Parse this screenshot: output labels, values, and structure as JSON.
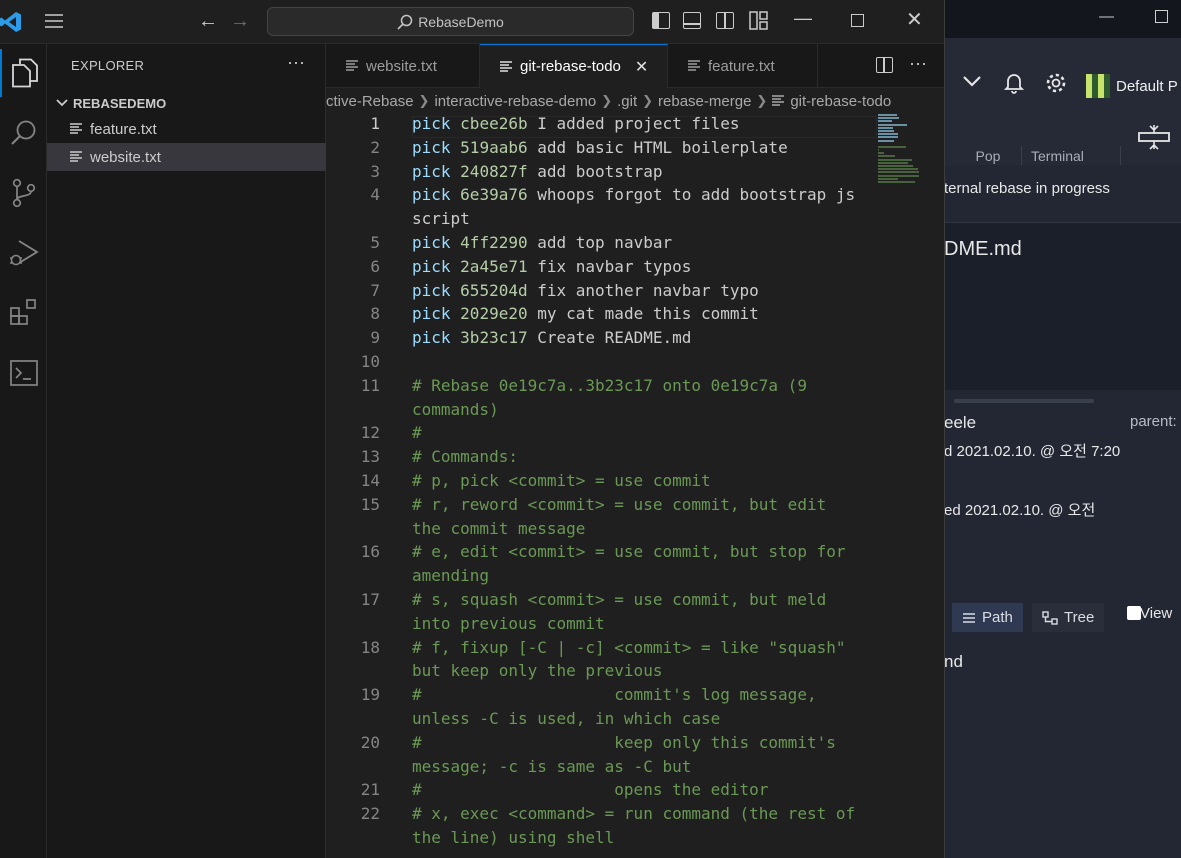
{
  "vscode": {
    "command_center": "RebaseDemo",
    "explorer": {
      "title": "EXPLORER",
      "folder": "REBASEDEMO",
      "files": [
        "feature.txt",
        "website.txt"
      ]
    },
    "tabs": [
      {
        "label": "website.txt"
      },
      {
        "label": "git-rebase-todo"
      },
      {
        "label": "feature.txt"
      }
    ],
    "breadcrumb": [
      "ctive-Rebase",
      "interactive-rebase-demo",
      ".git",
      "rebase-merge",
      "git-rebase-todo"
    ],
    "editor": {
      "current_line": 1,
      "lines": [
        {
          "n": "1",
          "kind": "pick",
          "cmd": "pick",
          "hash": "cbee26b",
          "msg": " I added project files"
        },
        {
          "n": "2",
          "kind": "pick",
          "cmd": "pick",
          "hash": "519aab6",
          "msg": " add basic HTML boilerplate"
        },
        {
          "n": "3",
          "kind": "pick",
          "cmd": "pick",
          "hash": "240827f",
          "msg": " add bootstrap"
        },
        {
          "n": "4",
          "kind": "pick",
          "cmd": "pick",
          "hash": "6e39a76",
          "msg": " whoops forgot to add bootstrap js script"
        },
        {
          "n": "5",
          "kind": "pick",
          "cmd": "pick",
          "hash": "4ff2290",
          "msg": " add top navbar"
        },
        {
          "n": "6",
          "kind": "pick",
          "cmd": "pick",
          "hash": "2a45e71",
          "msg": " fix navbar typos"
        },
        {
          "n": "7",
          "kind": "pick",
          "cmd": "pick",
          "hash": "655204d",
          "msg": " fix another navbar typo"
        },
        {
          "n": "8",
          "kind": "pick",
          "cmd": "pick",
          "hash": "2029e20",
          "msg": " my cat made this commit"
        },
        {
          "n": "9",
          "kind": "pick",
          "cmd": "pick",
          "hash": "3b23c17",
          "msg": " Create README.md"
        },
        {
          "n": "10",
          "kind": "blank",
          "text": ""
        },
        {
          "n": "11",
          "kind": "comment",
          "text": "# Rebase 0e19c7a..3b23c17 onto 0e19c7a (9 commands)"
        },
        {
          "n": "12",
          "kind": "comment",
          "text": "#"
        },
        {
          "n": "13",
          "kind": "comment",
          "text": "# Commands:"
        },
        {
          "n": "14",
          "kind": "comment",
          "text": "# p, pick <commit> = use commit"
        },
        {
          "n": "15",
          "kind": "comment",
          "text": "# r, reword <commit> = use commit, but edit the commit message"
        },
        {
          "n": "16",
          "kind": "comment",
          "text": "# e, edit <commit> = use commit, but stop for amending"
        },
        {
          "n": "17",
          "kind": "comment",
          "text": "# s, squash <commit> = use commit, but meld into previous commit"
        },
        {
          "n": "18",
          "kind": "comment",
          "text": "# f, fixup [-C | -c] <commit> = like \"squash\" but keep only the previous"
        },
        {
          "n": "19",
          "kind": "comment",
          "text": "#                    commit's log message, unless -C is used, in which case"
        },
        {
          "n": "20",
          "kind": "comment",
          "text": "#                    keep only this commit's message; -c is same as -C but"
        },
        {
          "n": "21",
          "kind": "comment",
          "text": "#                    opens the editor"
        },
        {
          "n": "22",
          "kind": "comment",
          "text": "# x, exec <command> = run command (the rest of the line) using shell"
        }
      ]
    }
  },
  "background_app": {
    "profile": "Default P",
    "toolbar": {
      "pop": "Pop",
      "terminal": "Terminal"
    },
    "banner": "ternal rebase in progress",
    "file_title": "DME.md",
    "author": "eele",
    "parent_label": "parent:",
    "authored": "d  2021.02.10. @ 오전 7:20",
    "committed": "ed  2021.02.10. @ 오전",
    "view_path": "Path",
    "view_tree": "Tree",
    "view_checkbox": "View",
    "list_item": "nd"
  },
  "colors": {
    "accent": "#0078d4",
    "comment": "#6a9955",
    "keyword": "#9cdcfe",
    "hash": "#b5cea8"
  }
}
